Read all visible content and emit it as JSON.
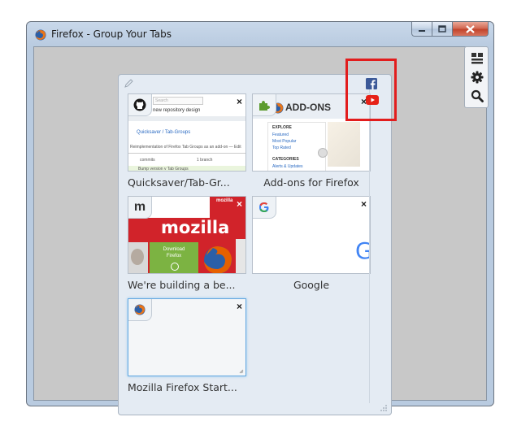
{
  "window": {
    "title": "Firefox - Group Your Tabs",
    "buttons": {
      "minimize": "minimize",
      "maximize": "maximize",
      "close": "close"
    }
  },
  "toolbar": {
    "icons": [
      "groups-view-icon",
      "gear-icon",
      "search-icon"
    ]
  },
  "stack_icons": [
    "facebook-icon",
    "youtube-icon"
  ],
  "tabs": [
    {
      "title": "Quicksaver/Tab-Gr...",
      "favicon": "github-icon",
      "preview": {
        "search_placeholder": "Search",
        "heading": "new repository design",
        "link": "Quicksaver / Tab-Groups",
        "desc": "Reimplementation of Firefox Tab Groups as an add-on — Edit",
        "stat1": "commits",
        "stat2": "1 branch",
        "row": "Bump version v Tab Groups"
      }
    },
    {
      "title": "Add-ons for Firefox",
      "favicon": "puzzle-piece-icon",
      "preview": {
        "heading": "ADD-ONS",
        "explore": "EXPLORE",
        "links": [
          "Featured",
          "Most Popular",
          "Top Rated"
        ],
        "categories": "CATEGORIES",
        "cat_item": "Alerts & Updates"
      }
    },
    {
      "title": "We're building a be...",
      "favicon": "m",
      "preview": {
        "brand": "mozilla",
        "corner": "mozilla",
        "cta_line1": "Download",
        "cta_line2": "Firefox"
      }
    },
    {
      "title": "Google",
      "favicon": "google-icon",
      "preview": {
        "logo_fragment": "G"
      }
    },
    {
      "title": "Mozilla Firefox Start...",
      "favicon": "firefox-icon",
      "preview": {}
    }
  ],
  "tab_close_glyph": "×",
  "colors": {
    "highlight": "#e21d1d",
    "mozilla_red": "#d1232a",
    "firefox_orange": "#e66000",
    "facebook": "#3b5998",
    "youtube": "#e62117"
  }
}
